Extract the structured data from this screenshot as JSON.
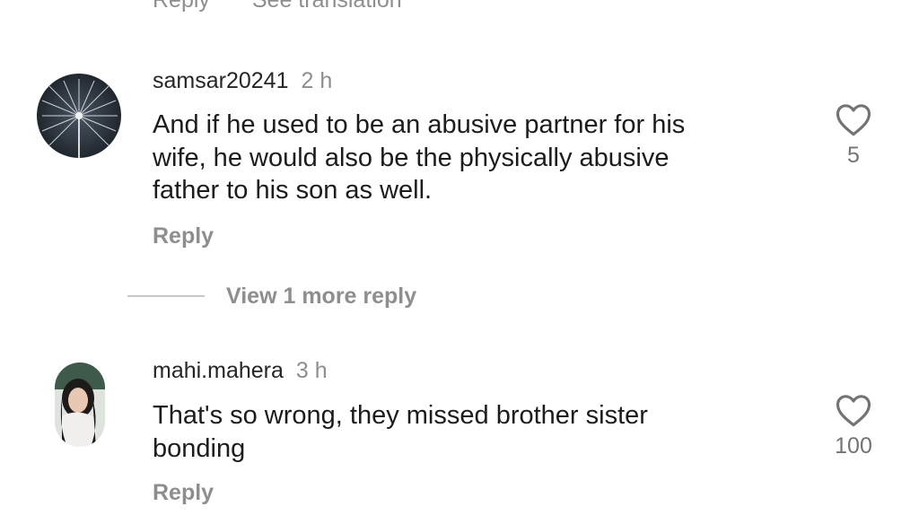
{
  "previous": {
    "reply_label": "Reply",
    "translate_label": "See translation"
  },
  "comments": [
    {
      "username": "samsar20241",
      "time": "2 h",
      "text_lines": [
        "And if he used to be an abusive partner for his",
        "wife, he would also be the physically abusive",
        "father to his son as well."
      ],
      "reply_label": "Reply",
      "likes": "5"
    },
    {
      "username": "mahi.mahera",
      "time": "3 h",
      "text_lines": [
        "That's so wrong, they missed brother sister",
        "bonding"
      ],
      "reply_label": "Reply",
      "likes": "100"
    }
  ],
  "view_more_replies": "View 1 more reply",
  "colors": {
    "secondary_text": "#8e8e8e",
    "primary_text": "#1c1c1c",
    "divider": "#c7c7c7"
  },
  "icons": {
    "like": "heart-outline-icon"
  }
}
